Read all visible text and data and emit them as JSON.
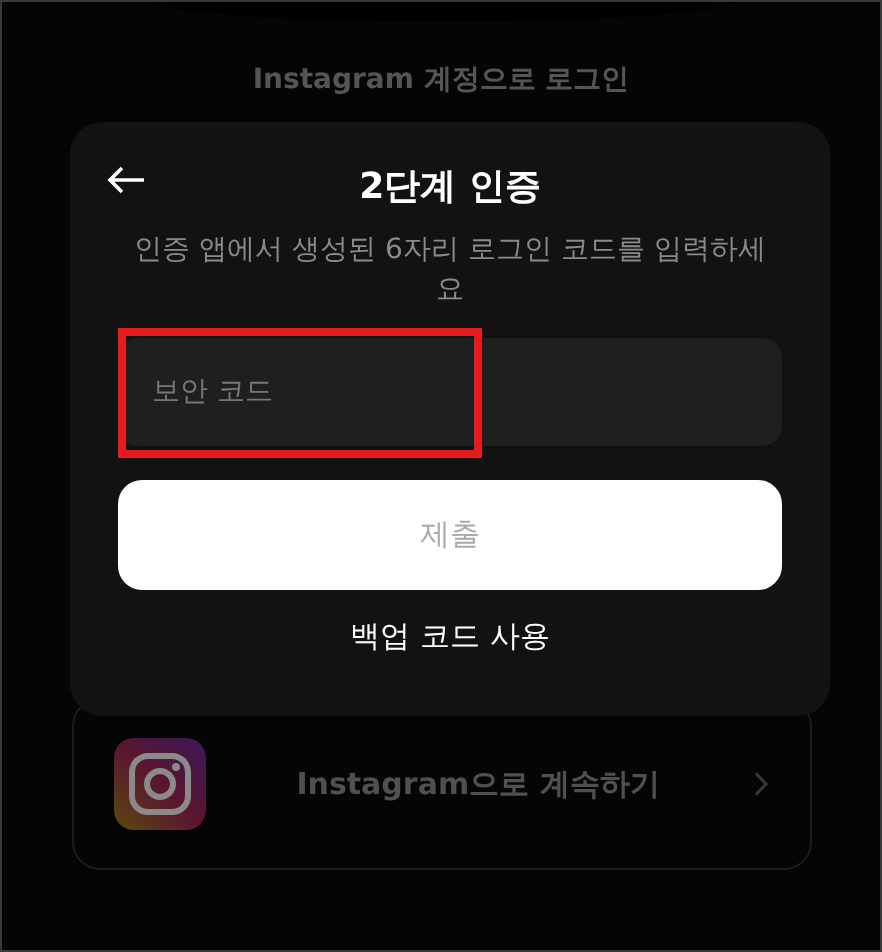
{
  "background": {
    "heading": "Instagram 계정으로 로그인",
    "continue_button": {
      "label": "Instagram으로 계속하기"
    }
  },
  "dialog": {
    "title": "2단계 인증",
    "description": "인증 앱에서 생성된 6자리 로그인 코드를 입력하세요",
    "field": {
      "placeholder": "보안 코드",
      "highlighted": true
    },
    "submit": {
      "label": "제출",
      "disabled": true
    },
    "link": "백업 코드 사용"
  }
}
